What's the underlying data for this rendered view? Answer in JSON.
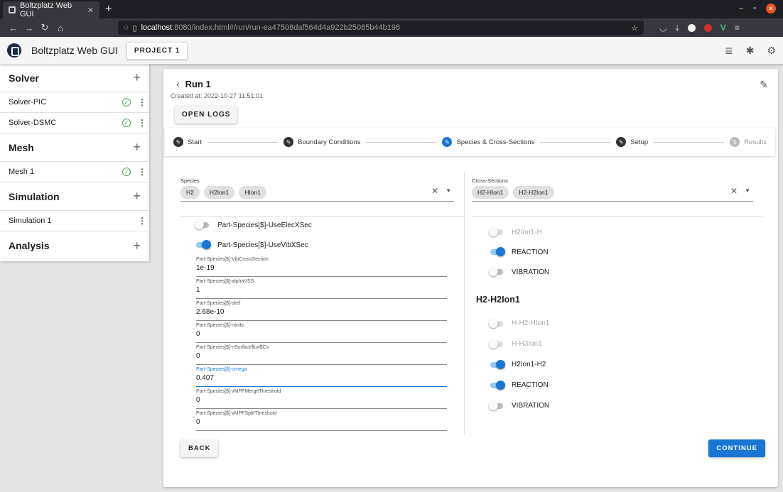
{
  "browser": {
    "tab_title": "Boltzplatz Web GUI",
    "url_host": "localhost",
    "url_path": ":8080/index.html#/run/run-ea47508daf564d4a922b25085b44b198"
  },
  "appbar": {
    "title": "Boltzplatz Web GUI",
    "project_button": "PROJECT 1"
  },
  "sidebar": {
    "solver": {
      "title": "Solver",
      "items": [
        "Solver-PIC",
        "Solver-DSMC"
      ]
    },
    "mesh": {
      "title": "Mesh",
      "items": [
        "Mesh 1"
      ]
    },
    "simulation": {
      "title": "Simulation",
      "items": [
        "Simulation 1"
      ]
    },
    "analysis": {
      "title": "Analysis"
    }
  },
  "run": {
    "title": "Run 1",
    "created": "Created at: 2022-10-27 11:51:01",
    "open_logs": "OPEN LOGS"
  },
  "stepper": {
    "steps": [
      "Start",
      "Boundary Conditions",
      "Species & Cross-Sections",
      "Setup",
      "Results"
    ],
    "pending_number": "5"
  },
  "species": {
    "label": "Species",
    "chips": [
      "H2",
      "H2Ion1",
      "HIon1"
    ],
    "toggles": [
      {
        "label": "Part-Species[$]-UseElecXSec",
        "on": false
      },
      {
        "label": "Part-Species[$]-UseVibXSec",
        "on": true
      }
    ],
    "fields": [
      {
        "label": "Part-Species[$]-VibCrossSection",
        "value": "1e-19"
      },
      {
        "label": "Part-Species[$]-alphaVSS",
        "value": "1"
      },
      {
        "label": "Part-Species[$]-dref",
        "value": "2.68e-10"
      },
      {
        "label": "Part-Species[$]-nInits",
        "value": "0"
      },
      {
        "label": "Part-Species[$]-nSurfacefluxBCs",
        "value": "0"
      },
      {
        "label": "Part-Species[$]-omega",
        "value": "0.407"
      },
      {
        "label": "Part-Species[$]-vMPFMergeThreshold",
        "value": "0"
      },
      {
        "label": "Part-Species[$]-vMPFSplitThreshold",
        "value": "0"
      }
    ]
  },
  "cross_sections": {
    "label": "Cross-Sections",
    "chips": [
      "H2-HIon1",
      "H2-H2Ion1"
    ],
    "group1": [
      {
        "label": "H2Ion1-H",
        "on": false,
        "disabled": true
      },
      {
        "label": "REACTION",
        "on": true,
        "disabled": false
      },
      {
        "label": "VIBRATION",
        "on": false,
        "disabled": false
      }
    ],
    "group2_title": "H2-H2Ion1",
    "group2": [
      {
        "label": "H-H2-HIon1",
        "on": false,
        "disabled": true
      },
      {
        "label": "H-H3Ion1",
        "on": false,
        "disabled": true
      },
      {
        "label": "H2Ion1-H2",
        "on": true,
        "disabled": false
      },
      {
        "label": "REACTION",
        "on": true,
        "disabled": false
      },
      {
        "label": "VIBRATION",
        "on": false,
        "disabled": false
      }
    ]
  },
  "actions": {
    "back": "BACK",
    "continue": "CONTINUE"
  }
}
